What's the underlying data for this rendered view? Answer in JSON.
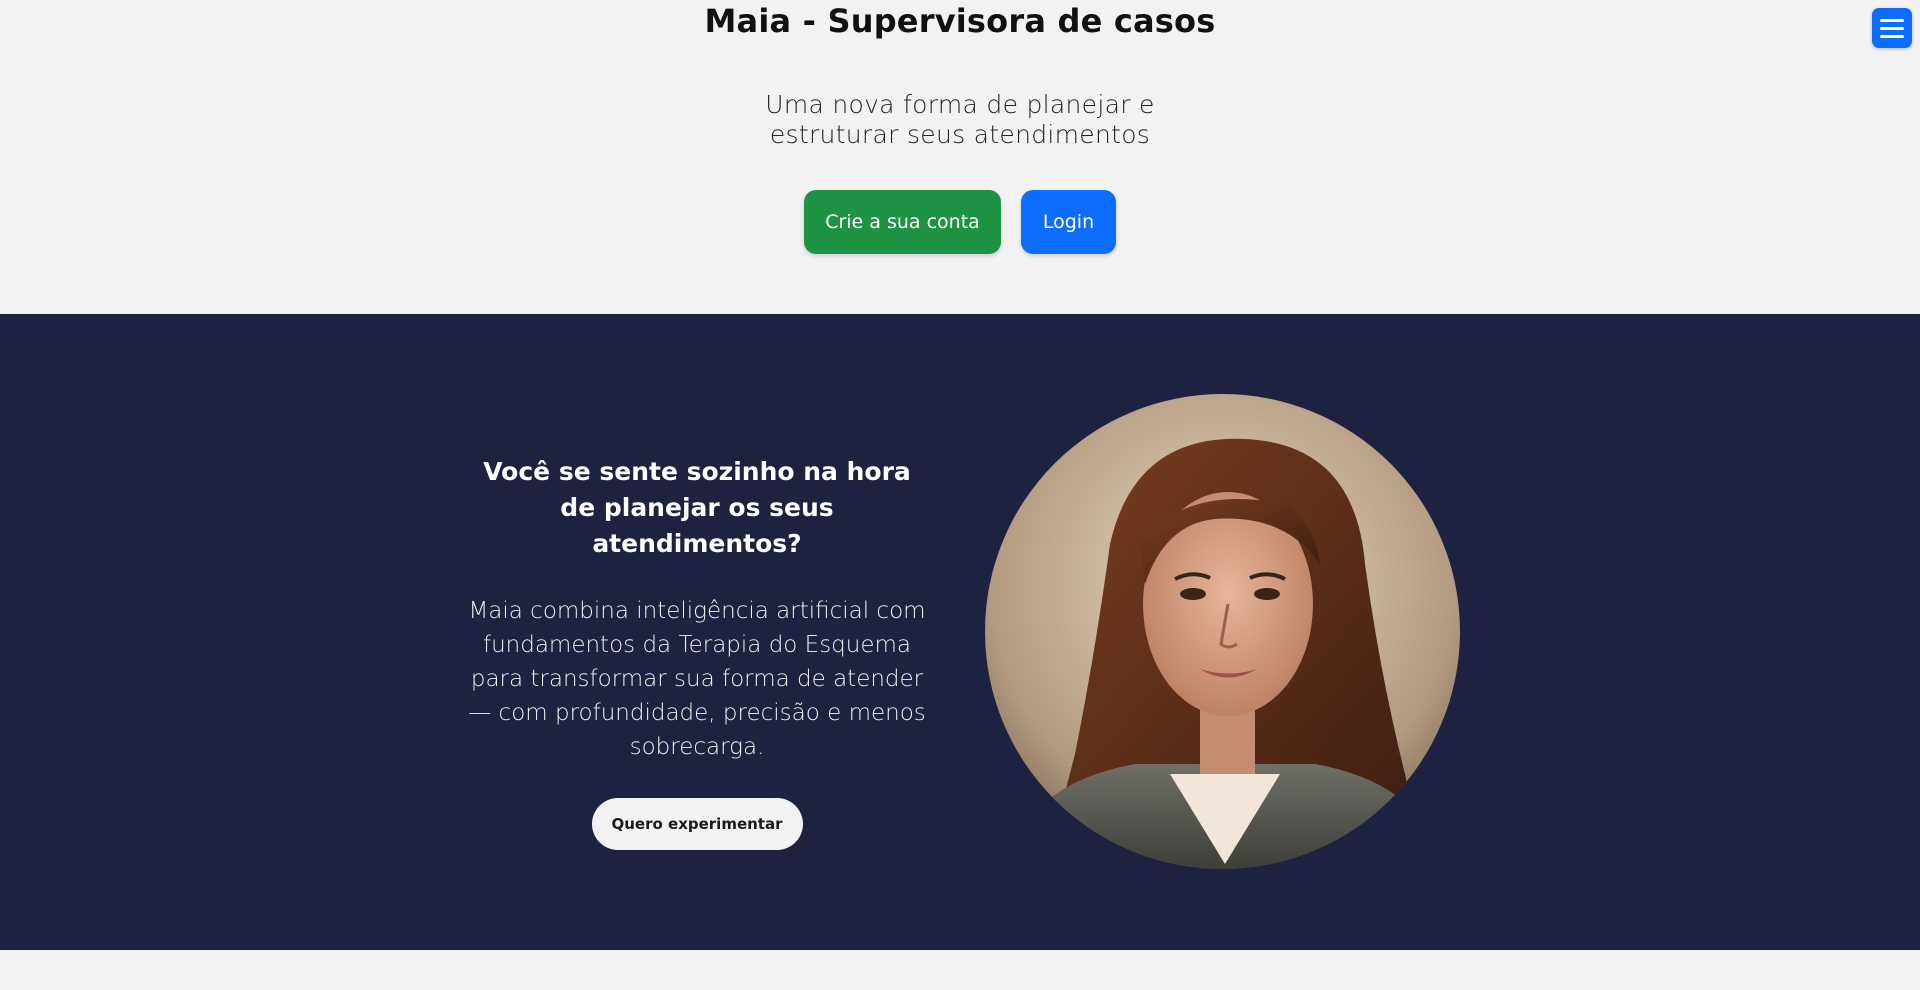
{
  "hero": {
    "title": "Maia - Supervisora de casos",
    "subtitle": "Uma nova forma de planejar e estruturar seus atendimentos",
    "signup_label": "Crie a sua conta",
    "login_label": "Login"
  },
  "menu": {
    "icon": "hamburger-menu-icon"
  },
  "feature": {
    "heading": "Você se sente sozinho na hora de planejar os seus atendimentos?",
    "body": "Maia combina inteligência artificial com fundamentos da Terapia do Esquema para transformar sua forma de atender — com profundidade, precisão e menos sobrecarga.",
    "cta_label": "Quero experimentar",
    "image": "portrait-of-woman"
  },
  "colors": {
    "green_button": "#1f9344",
    "blue_button": "#0d6efd",
    "navy_section": "#1d2240",
    "light_background": "#f2f2f2"
  }
}
